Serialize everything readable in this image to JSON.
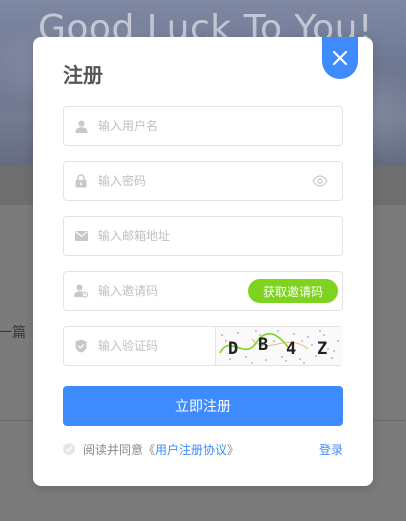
{
  "background": {
    "hero_title": "Good Luck To You!",
    "content_snippet": "一篇"
  },
  "modal": {
    "title": "注册",
    "fields": {
      "username_placeholder": "输入用户名",
      "password_placeholder": "输入密码",
      "email_placeholder": "输入邮箱地址",
      "invite_placeholder": "输入邀请码",
      "captcha_placeholder": "输入验证码"
    },
    "invite_button": "获取邀请码",
    "captcha_chars": [
      "D",
      "B",
      "4",
      "Z"
    ],
    "submit_label": "立即注册",
    "agree": {
      "prefix": "阅读并同意《",
      "link": "用户注册协议",
      "suffix": "》"
    },
    "login_label": "登录"
  },
  "colors": {
    "primary": "#3d8bfd",
    "invite": "#7ed321",
    "icon": "#c8c8c8"
  }
}
